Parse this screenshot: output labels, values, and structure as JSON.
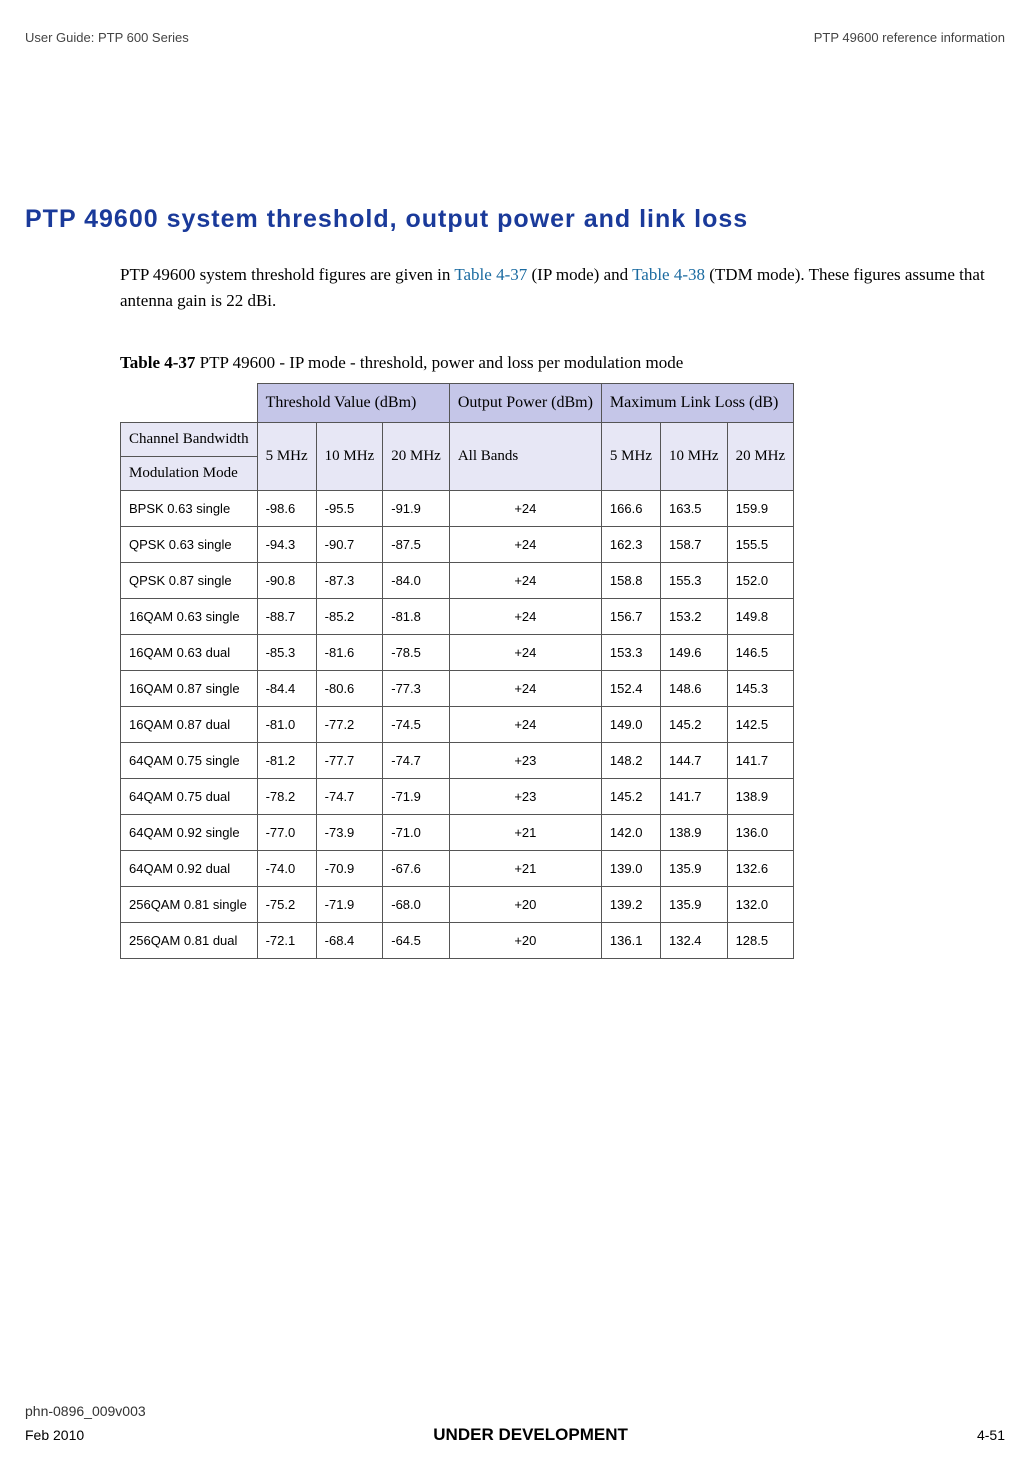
{
  "header": {
    "left": "User Guide: PTP 600 Series",
    "right": "PTP 49600 reference information"
  },
  "section_title": "PTP 49600 system threshold, output power and link loss",
  "body_p1a": "PTP 49600 system threshold figures are given in ",
  "body_link1": "Table 4-37",
  "body_p1b": " (IP mode) and ",
  "body_link2": "Table 4-38",
  "body_p1c": " (TDM mode). These figures assume that antenna gain is 22 dBi.",
  "caption_bold": "Table 4-37",
  "caption_rest": "  PTP 49600 - IP mode - threshold, power and loss per modulation mode",
  "table": {
    "hdr_threshold": "Threshold Value (dBm)",
    "hdr_output": "Output Power (dBm)",
    "hdr_maxloss": "Maximum Link Loss (dB)",
    "row2_channel": "Channel Bandwidth",
    "row2_mod": "Modulation Mode",
    "col_5mhz": "5 MHz",
    "col_10mhz": "10 MHz",
    "col_20mhz_a": "20 MHz",
    "col_allbands": "All Bands",
    "col_5mhz_b": "5 MHz",
    "col_10mhz_b": "10 MHz",
    "col_20mhz_b": "20 MHz",
    "rows": [
      {
        "m": "BPSK 0.63 single",
        "t5": "-98.6",
        "t10": "-95.5",
        "t20": "-91.9",
        "op": "+24",
        "l5": "166.6",
        "l10": "163.5",
        "l20": "159.9"
      },
      {
        "m": "QPSK 0.63 single",
        "t5": "-94.3",
        "t10": "-90.7",
        "t20": "-87.5",
        "op": "+24",
        "l5": "162.3",
        "l10": "158.7",
        "l20": "155.5"
      },
      {
        "m": "QPSK 0.87 single",
        "t5": "-90.8",
        "t10": "-87.3",
        "t20": "-84.0",
        "op": "+24",
        "l5": "158.8",
        "l10": "155.3",
        "l20": "152.0"
      },
      {
        "m": "16QAM 0.63 single",
        "t5": "-88.7",
        "t10": "-85.2",
        "t20": "-81.8",
        "op": "+24",
        "l5": "156.7",
        "l10": "153.2",
        "l20": "149.8"
      },
      {
        "m": "16QAM 0.63 dual",
        "t5": "-85.3",
        "t10": "-81.6",
        "t20": "-78.5",
        "op": "+24",
        "l5": "153.3",
        "l10": "149.6",
        "l20": "146.5"
      },
      {
        "m": "16QAM 0.87 single",
        "t5": "-84.4",
        "t10": "-80.6",
        "t20": "-77.3",
        "op": "+24",
        "l5": "152.4",
        "l10": "148.6",
        "l20": "145.3"
      },
      {
        "m": "16QAM 0.87 dual",
        "t5": "-81.0",
        "t10": "-77.2",
        "t20": "-74.5",
        "op": "+24",
        "l5": "149.0",
        "l10": "145.2",
        "l20": "142.5"
      },
      {
        "m": "64QAM 0.75 single",
        "t5": "-81.2",
        "t10": "-77.7",
        "t20": "-74.7",
        "op": "+23",
        "l5": "148.2",
        "l10": "144.7",
        "l20": "141.7"
      },
      {
        "m": "64QAM 0.75 dual",
        "t5": "-78.2",
        "t10": "-74.7",
        "t20": "-71.9",
        "op": "+23",
        "l5": "145.2",
        "l10": "141.7",
        "l20": "138.9"
      },
      {
        "m": "64QAM 0.92 single",
        "t5": "-77.0",
        "t10": "-73.9",
        "t20": "-71.0",
        "op": "+21",
        "l5": "142.0",
        "l10": "138.9",
        "l20": "136.0"
      },
      {
        "m": "64QAM 0.92 dual",
        "t5": "-74.0",
        "t10": "-70.9",
        "t20": "-67.6",
        "op": "+21",
        "l5": "139.0",
        "l10": "135.9",
        "l20": "132.6"
      },
      {
        "m": "256QAM 0.81 single",
        "t5": "-75.2",
        "t10": "-71.9",
        "t20": "-68.0",
        "op": "+20",
        "l5": "139.2",
        "l10": "135.9",
        "l20": "132.0"
      },
      {
        "m": "256QAM 0.81 dual",
        "t5": "-72.1",
        "t10": "-68.4",
        "t20": "-64.5",
        "op": "+20",
        "l5": "136.1",
        "l10": "132.4",
        "l20": "128.5"
      }
    ]
  },
  "footer": {
    "doc_id": "phn-0896_009v003",
    "date": "Feb 2010",
    "dev": "UNDER DEVELOPMENT",
    "page": "4-51"
  }
}
